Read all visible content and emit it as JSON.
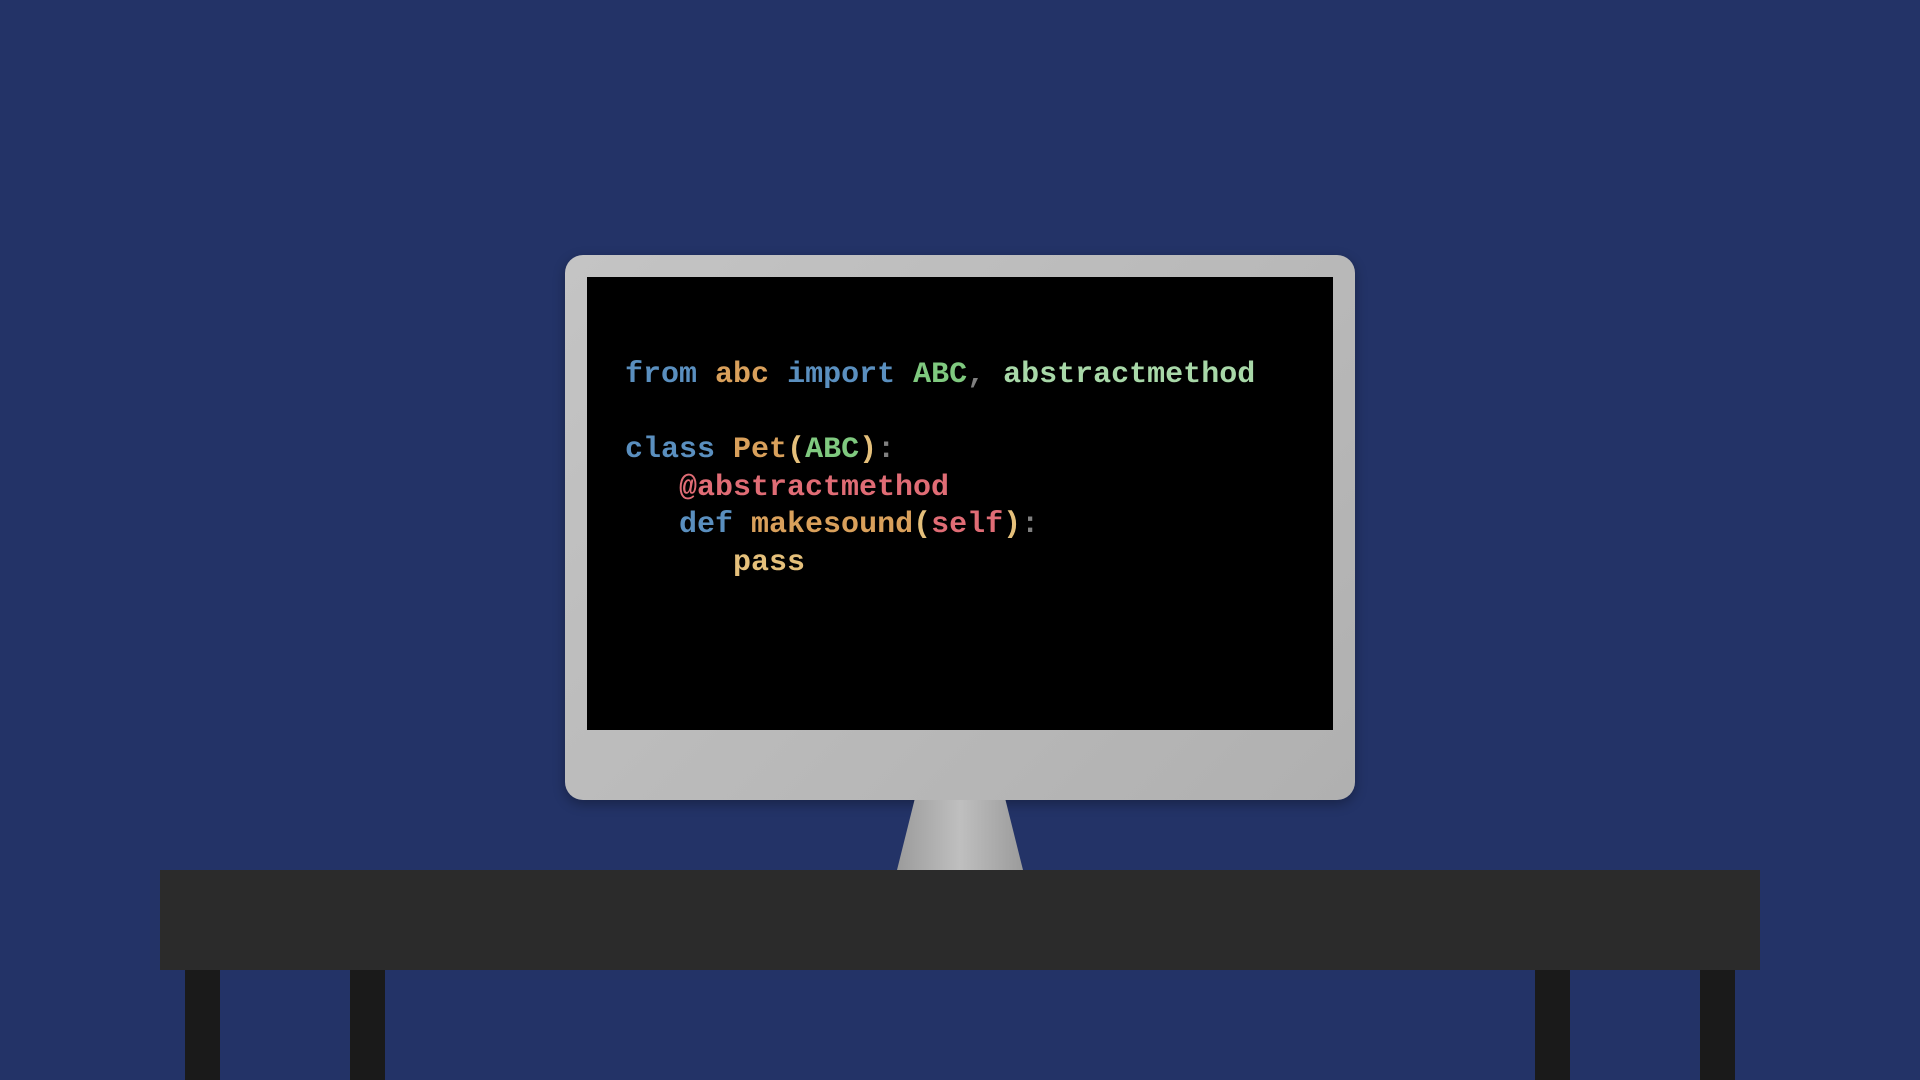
{
  "code": {
    "line1": {
      "from": "from",
      "module": "abc",
      "import": "import",
      "name1": "ABC",
      "comma": ",",
      "name2": "abstractmethod"
    },
    "line3": {
      "class": "class",
      "name": "Pet",
      "lparen": "(",
      "base": "ABC",
      "rparen": ")",
      "colon": ":"
    },
    "line4": {
      "decorator": "@abstractmethod"
    },
    "line5": {
      "def": "def",
      "fname": "makesound",
      "lparen": "(",
      "self": "self",
      "rparen": ")",
      "colon": ":"
    },
    "line6": {
      "pass": "pass"
    }
  }
}
